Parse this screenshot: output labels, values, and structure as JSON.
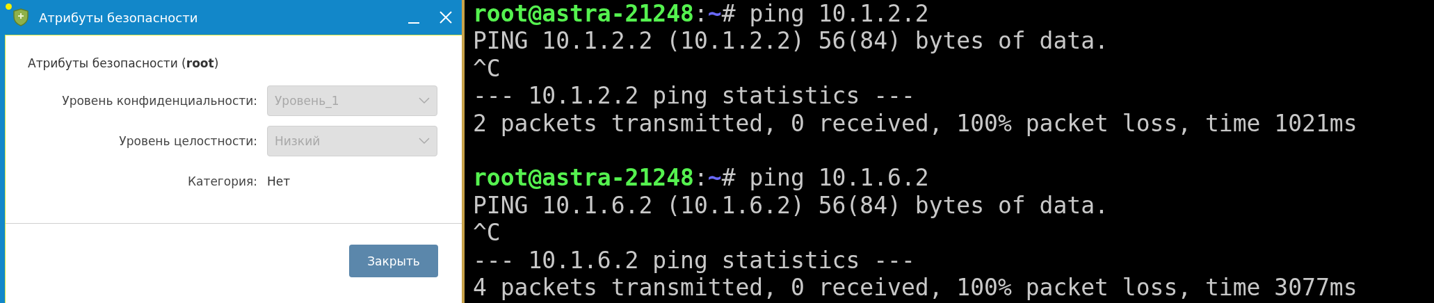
{
  "dialog": {
    "title": "Атрибуты безопасности",
    "heading": "Атрибуты безопасности (**root**)",
    "fields": [
      {
        "kind": "combo",
        "label": "Уровень конфиденциальности:",
        "value": "Уровень_1",
        "disabled": true
      },
      {
        "kind": "combo",
        "label": "Уровень целостности:",
        "value": "Низкий",
        "disabled": true
      },
      {
        "kind": "text",
        "label": "Категория:",
        "value": "Нет"
      }
    ],
    "buttons": [
      "Закрыть"
    ]
  },
  "terminal": {
    "lines": [
      {
        "kind": "prompt",
        "host": "root@astra-21248",
        "sep": ":",
        "path": "~",
        "command": "# ping 10.1.2.2"
      },
      {
        "kind": "output",
        "text": "PING 10.1.2.2 (10.1.2.2) 56(84) bytes of data."
      },
      {
        "kind": "output",
        "text": "^C"
      },
      {
        "kind": "output",
        "text": "--- 10.1.2.2 ping statistics ---"
      },
      {
        "kind": "output",
        "text": "2 packets transmitted, 0 received, 100% packet loss, time 1021ms"
      },
      {
        "kind": "blank"
      },
      {
        "kind": "prompt",
        "host": "root@astra-21248",
        "sep": ":",
        "path": "~",
        "command": "# ping 10.1.6.2"
      },
      {
        "kind": "output",
        "text": "PING 10.1.6.2 (10.1.6.2) 56(84) bytes of data."
      },
      {
        "kind": "output",
        "text": "^C"
      },
      {
        "kind": "output",
        "text": "--- 10.1.6.2 ping statistics ---"
      },
      {
        "kind": "output",
        "text": "4 packets transmitted, 0 received, 100% packet loss, time 3077ms"
      }
    ]
  }
}
